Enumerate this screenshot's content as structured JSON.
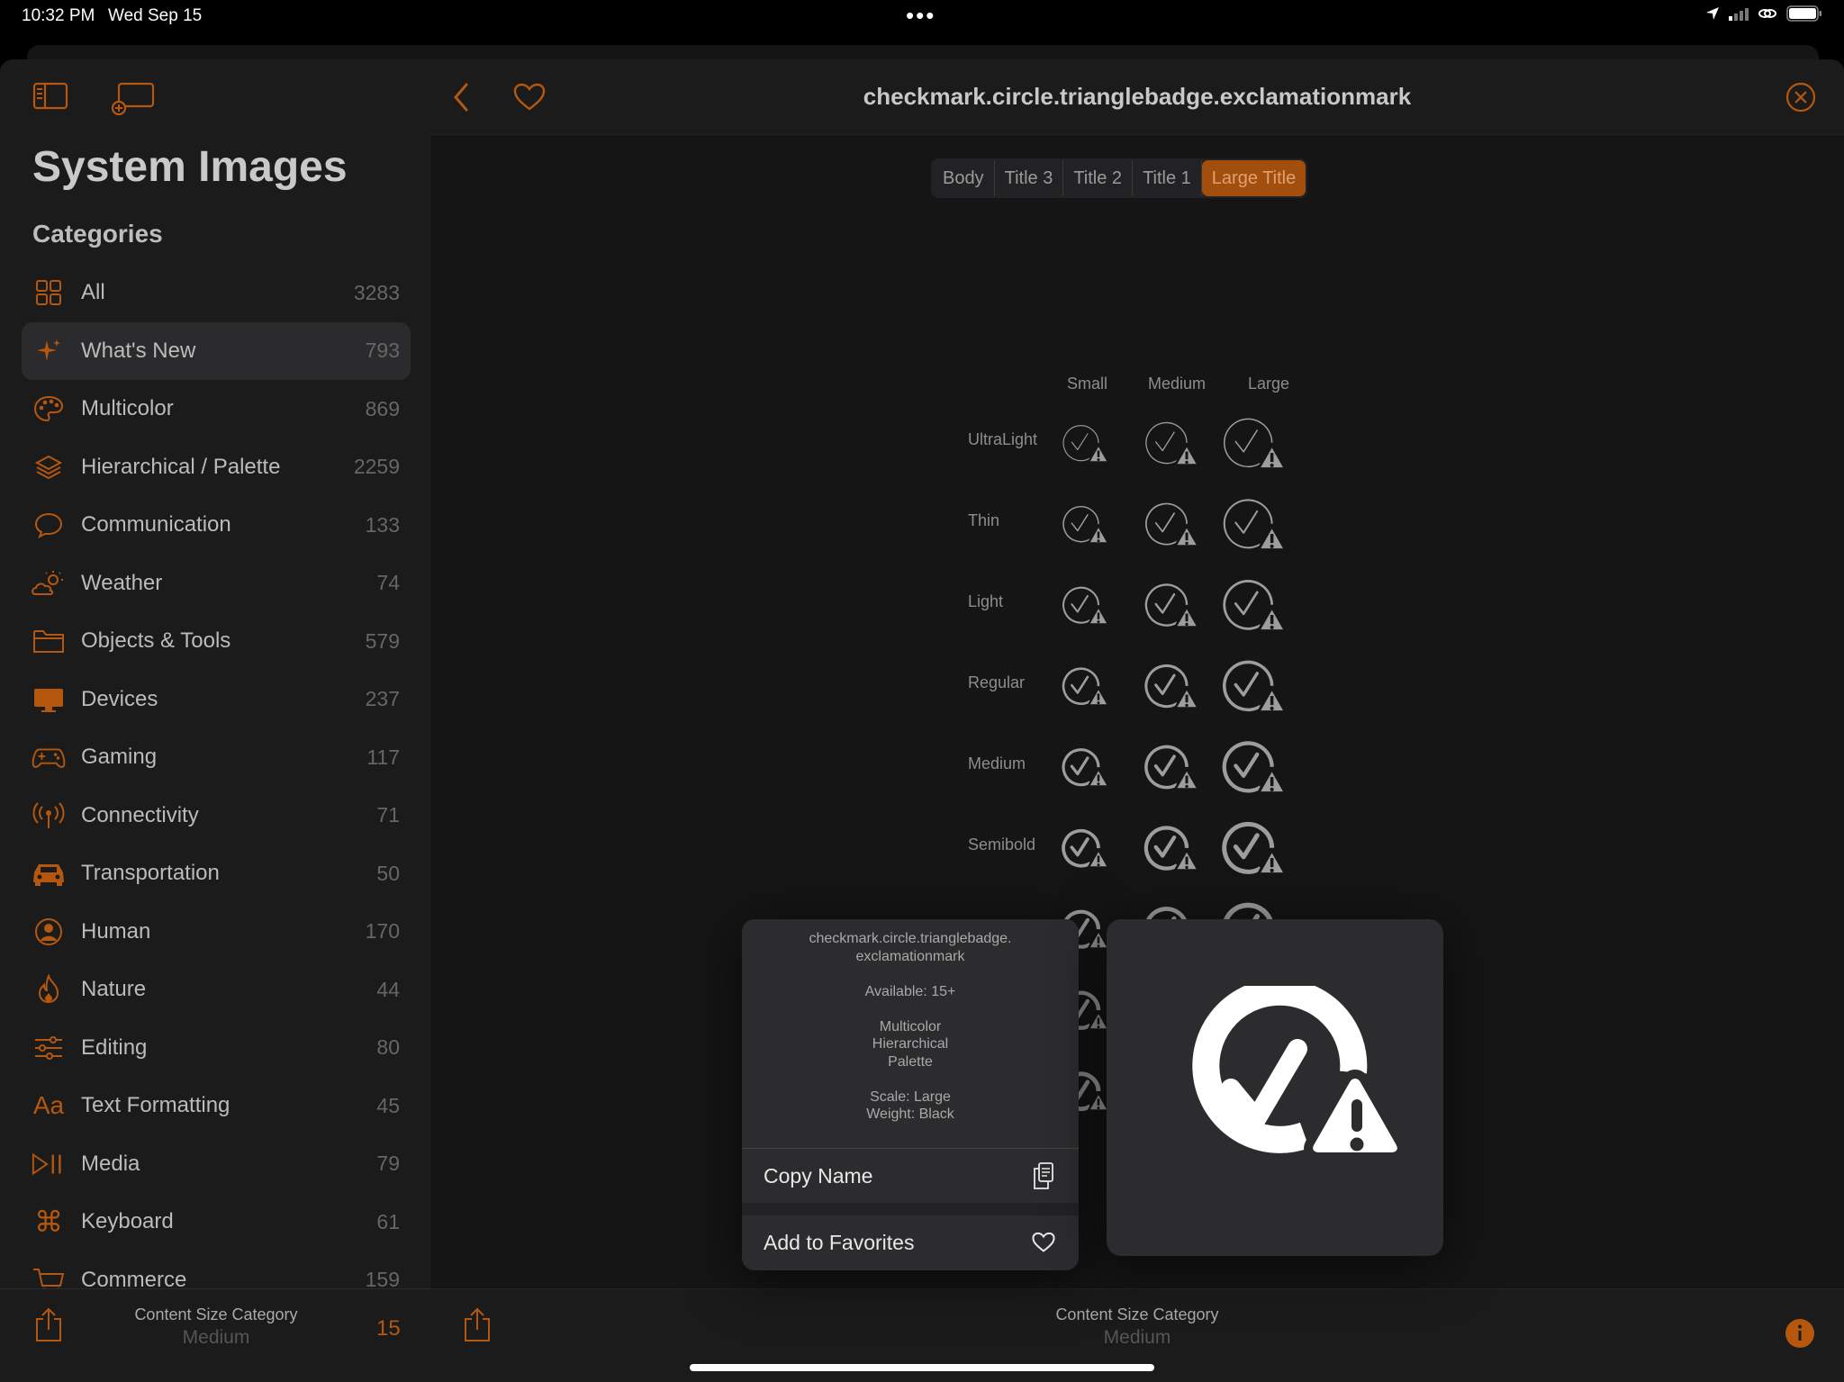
{
  "status": {
    "time": "10:32 PM",
    "date": "Wed Sep 15"
  },
  "sidebar": {
    "title": "System Images",
    "categories_heading": "Categories",
    "items": [
      {
        "label": "All",
        "count": "3283",
        "icon": "grid-icon"
      },
      {
        "label": "What's New",
        "count": "793",
        "icon": "sparkles-icon"
      },
      {
        "label": "Multicolor",
        "count": "869",
        "icon": "palette-icon"
      },
      {
        "label": "Hierarchical / Palette",
        "count": "2259",
        "icon": "layers-icon"
      },
      {
        "label": "Communication",
        "count": "133",
        "icon": "bubble-icon"
      },
      {
        "label": "Weather",
        "count": "74",
        "icon": "cloud-sun-icon"
      },
      {
        "label": "Objects & Tools",
        "count": "579",
        "icon": "folder-icon"
      },
      {
        "label": "Devices",
        "count": "237",
        "icon": "display-icon"
      },
      {
        "label": "Gaming",
        "count": "117",
        "icon": "gamecontroller-icon"
      },
      {
        "label": "Connectivity",
        "count": "71",
        "icon": "antenna-icon"
      },
      {
        "label": "Transportation",
        "count": "50",
        "icon": "car-icon"
      },
      {
        "label": "Human",
        "count": "170",
        "icon": "person-circle-icon"
      },
      {
        "label": "Nature",
        "count": "44",
        "icon": "flame-icon"
      },
      {
        "label": "Editing",
        "count": "80",
        "icon": "sliders-icon"
      },
      {
        "label": "Text Formatting",
        "count": "45",
        "icon": "textformat-icon"
      },
      {
        "label": "Media",
        "count": "79",
        "icon": "play-pause-icon"
      },
      {
        "label": "Keyboard",
        "count": "61",
        "icon": "command-icon"
      },
      {
        "label": "Commerce",
        "count": "159",
        "icon": "cart-icon"
      }
    ],
    "bottom": {
      "caption": "Content Size Category",
      "value": "Medium",
      "number": "15"
    }
  },
  "main": {
    "title": "checkmark.circle.trianglebadge.exclamationmark",
    "segments": [
      "Body",
      "Title 3",
      "Title 2",
      "Title 1",
      "Large Title"
    ],
    "active_segment": "Large Title",
    "columns": [
      "Small",
      "Medium",
      "Large"
    ],
    "rows": [
      "UltraLight",
      "Thin",
      "Light",
      "Regular",
      "Medium",
      "Semibold"
    ],
    "bottom": {
      "caption": "Content Size Category",
      "value": "Medium"
    }
  },
  "popover": {
    "name_line1": "checkmark.circle.trianglebadge.",
    "name_line2": "exclamationmark",
    "available": "Available: 15+",
    "mode1": "Multicolor",
    "mode2": "Hierarchical",
    "mode3": "Palette",
    "scale": "Scale: Large",
    "weight": "Weight: Black",
    "copy_name": "Copy Name",
    "add_favorites": "Add to Favorites"
  },
  "colors": {
    "accent": "#b5570e",
    "accent_dim": "#a24f0e",
    "symbol": "#9d9d9d"
  }
}
